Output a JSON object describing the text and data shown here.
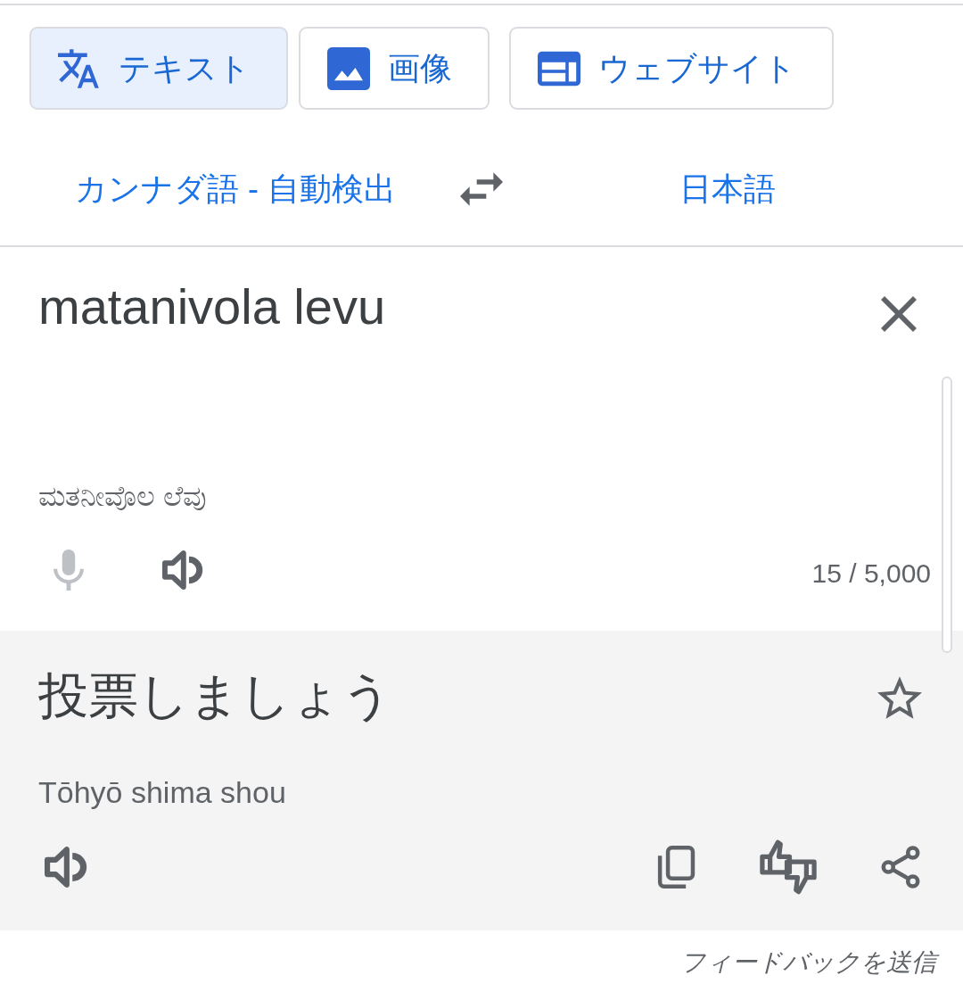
{
  "mode_tabs": [
    {
      "kind": "text",
      "label": "テキスト",
      "selected": true
    },
    {
      "kind": "image",
      "label": "画像",
      "selected": false
    },
    {
      "kind": "website",
      "label": "ウェブサイト",
      "selected": false
    }
  ],
  "language_bar": {
    "source": "カンナダ語 - 自動検出",
    "target": "日本語"
  },
  "input": {
    "value": "matanivola levu",
    "transliteration": "ಮತನೀವೊಲ ಲೆವು",
    "microphone": {
      "disabled": true
    },
    "char_count": "15 / 5,000"
  },
  "output": {
    "text": "投票しましょう",
    "starred": false,
    "romanization": "Tōhyō shima shou"
  },
  "feedback_link": "フィードバックを送信"
}
